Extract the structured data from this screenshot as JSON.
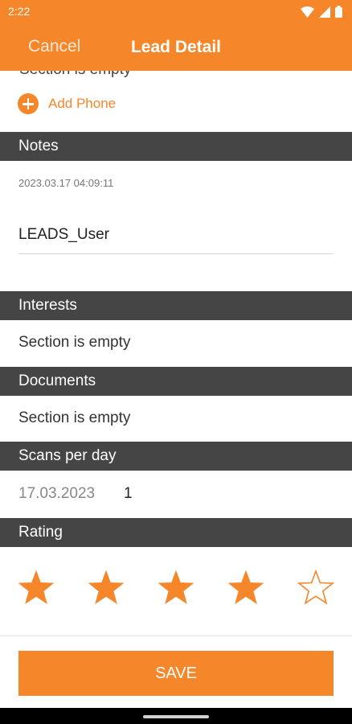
{
  "status_bar": {
    "time": "2:22"
  },
  "header": {
    "cancel_label": "Cancel",
    "title": "Lead Detail"
  },
  "phone": {
    "cut_text": "Section is empty",
    "add_label": "Add Phone"
  },
  "notes": {
    "title": "Notes",
    "date": "2023.03.17 04:09:11",
    "user": "LEADS_User"
  },
  "interests": {
    "title": "Interests",
    "empty_text": "Section is empty"
  },
  "documents": {
    "title": "Documents",
    "empty_text": "Section is empty"
  },
  "scans": {
    "title": "Scans per day",
    "date": "17.03.2023",
    "count": "1"
  },
  "rating": {
    "title": "Rating",
    "value": 4,
    "max": 5
  },
  "footer": {
    "save_label": "SAVE"
  },
  "colors": {
    "accent": "#f6862a",
    "section_header": "#454545"
  }
}
